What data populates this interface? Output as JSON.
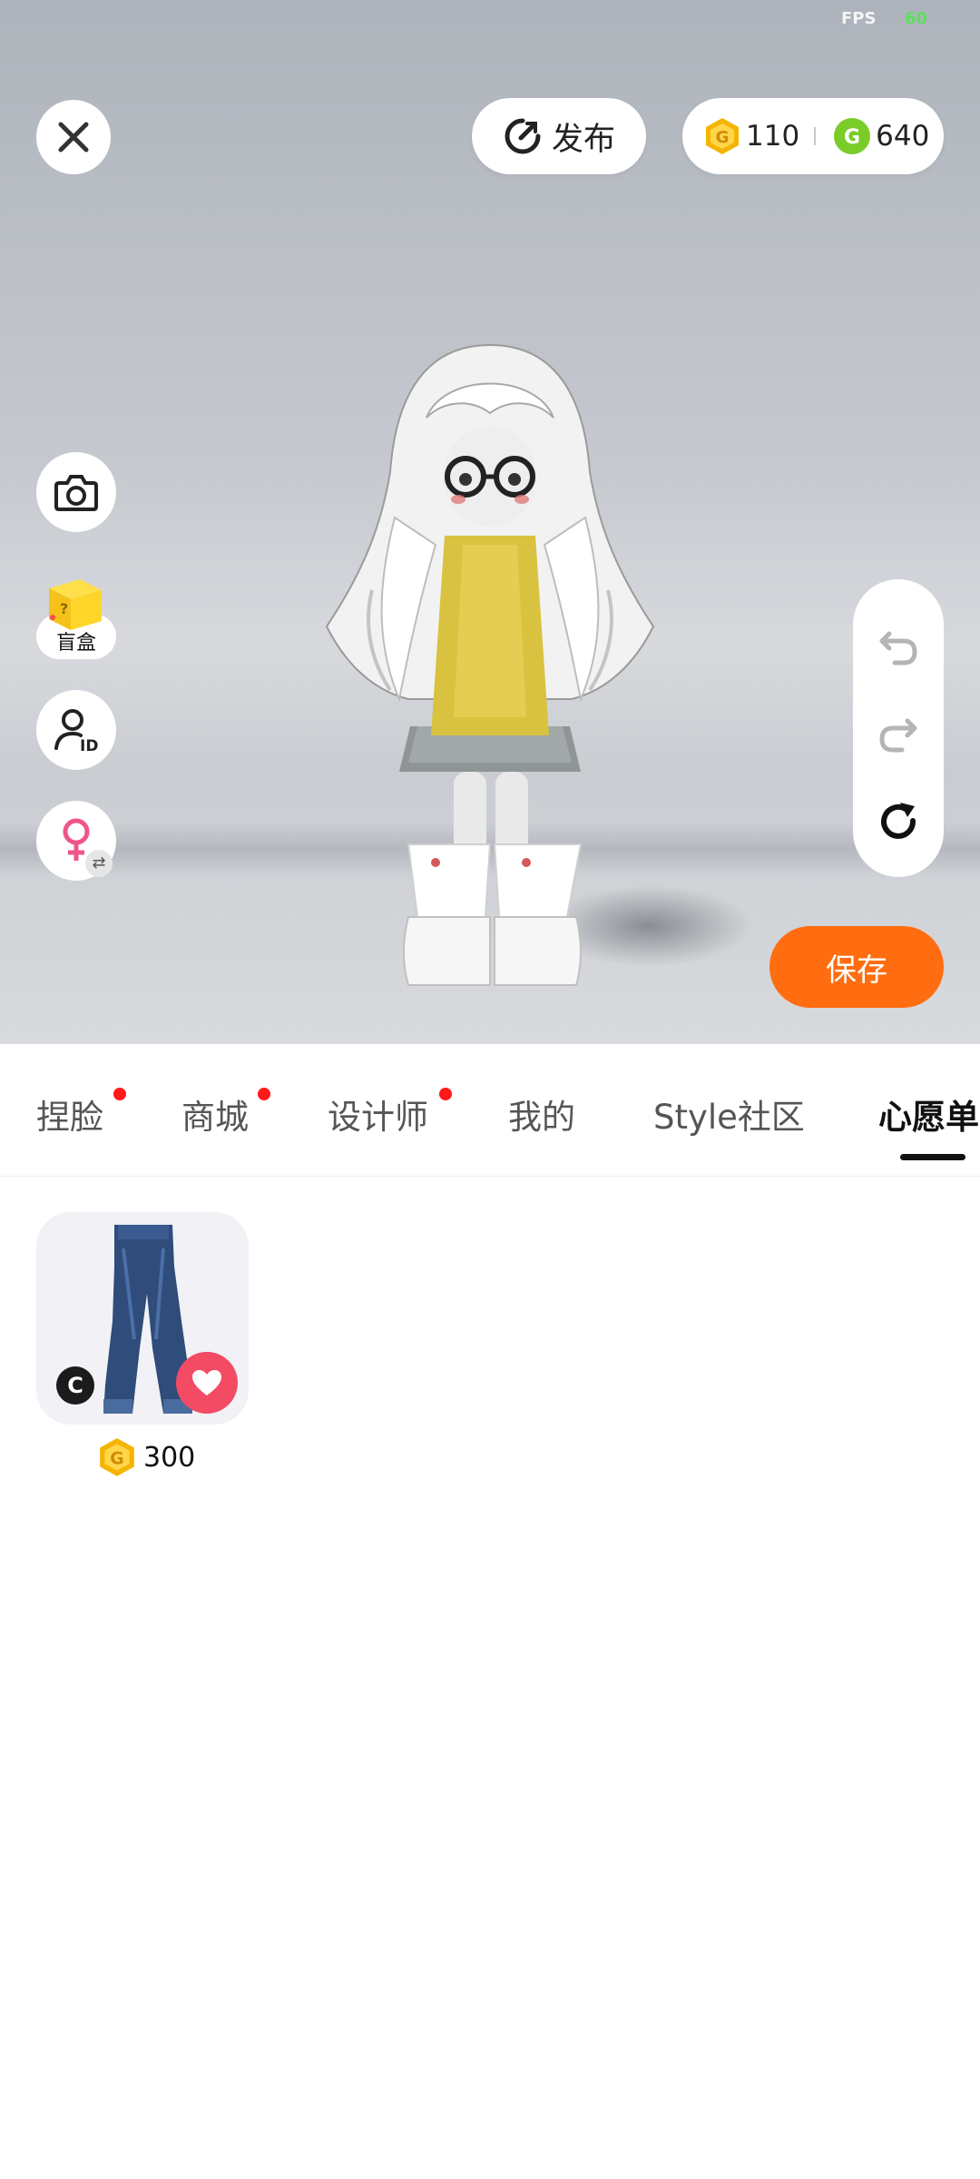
{
  "status": {
    "fps_label": "FPS",
    "fps_value": "60"
  },
  "header": {
    "publish_label": "发布",
    "gold_amount": "110",
    "green_amount": "640"
  },
  "sidebar": {
    "camera_icon": "camera-icon",
    "blind_box_label": "盲盒",
    "profile_icon": "user-id-icon",
    "gender_icon": "female-icon"
  },
  "history": {
    "undo_icon": "undo-icon",
    "redo_icon": "redo-icon",
    "reset_icon": "reset-icon"
  },
  "save_label": "保存",
  "tabs": [
    {
      "label": "捏脸",
      "badge": true
    },
    {
      "label": "商城",
      "badge": true
    },
    {
      "label": "设计师",
      "badge": true
    },
    {
      "label": "我的",
      "badge": false
    },
    {
      "label": "Style社区",
      "badge": false
    },
    {
      "label": "心愿单",
      "badge": false,
      "active": true
    }
  ],
  "wishlist": {
    "items": [
      {
        "name_icon": "jeans-icon",
        "creator_badge": "C",
        "price": "300",
        "favorited": true
      }
    ]
  },
  "colors": {
    "accent": "#ff6d10",
    "heart": "#f24b63",
    "gold_coin": "#f4b400",
    "green_coin": "#7acc29",
    "badge_dot": "#ff1a1a"
  }
}
